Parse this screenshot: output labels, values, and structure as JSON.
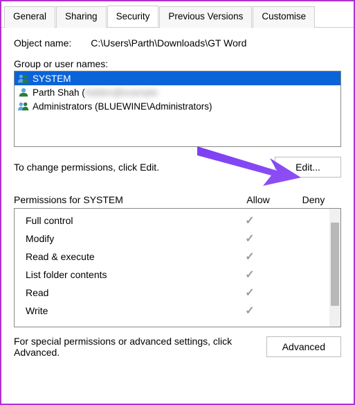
{
  "tabs": {
    "general": "General",
    "sharing": "Sharing",
    "security": "Security",
    "previous": "Previous Versions",
    "customise": "Customise"
  },
  "object_name_label": "Object name:",
  "object_name_value": "C:\\Users\\Parth\\Downloads\\GT Word",
  "group_label": "Group or user names:",
  "users": {
    "system": "SYSTEM",
    "parth": "Parth Shah (",
    "parth_hidden": "hidden@example",
    "admins": "Administrators (BLUEWINE\\Administrators)"
  },
  "edit_text": "To change permissions, click Edit.",
  "edit_btn": "Edit...",
  "perm_title": "Permissions for SYSTEM",
  "col_allow": "Allow",
  "col_deny": "Deny",
  "perms": {
    "full": "Full control",
    "modify": "Modify",
    "readexec": "Read & execute",
    "listfolder": "List folder contents",
    "read": "Read",
    "write": "Write"
  },
  "adv_text": "For special permissions or advanced settings, click Advanced.",
  "adv_btn": "Advanced"
}
